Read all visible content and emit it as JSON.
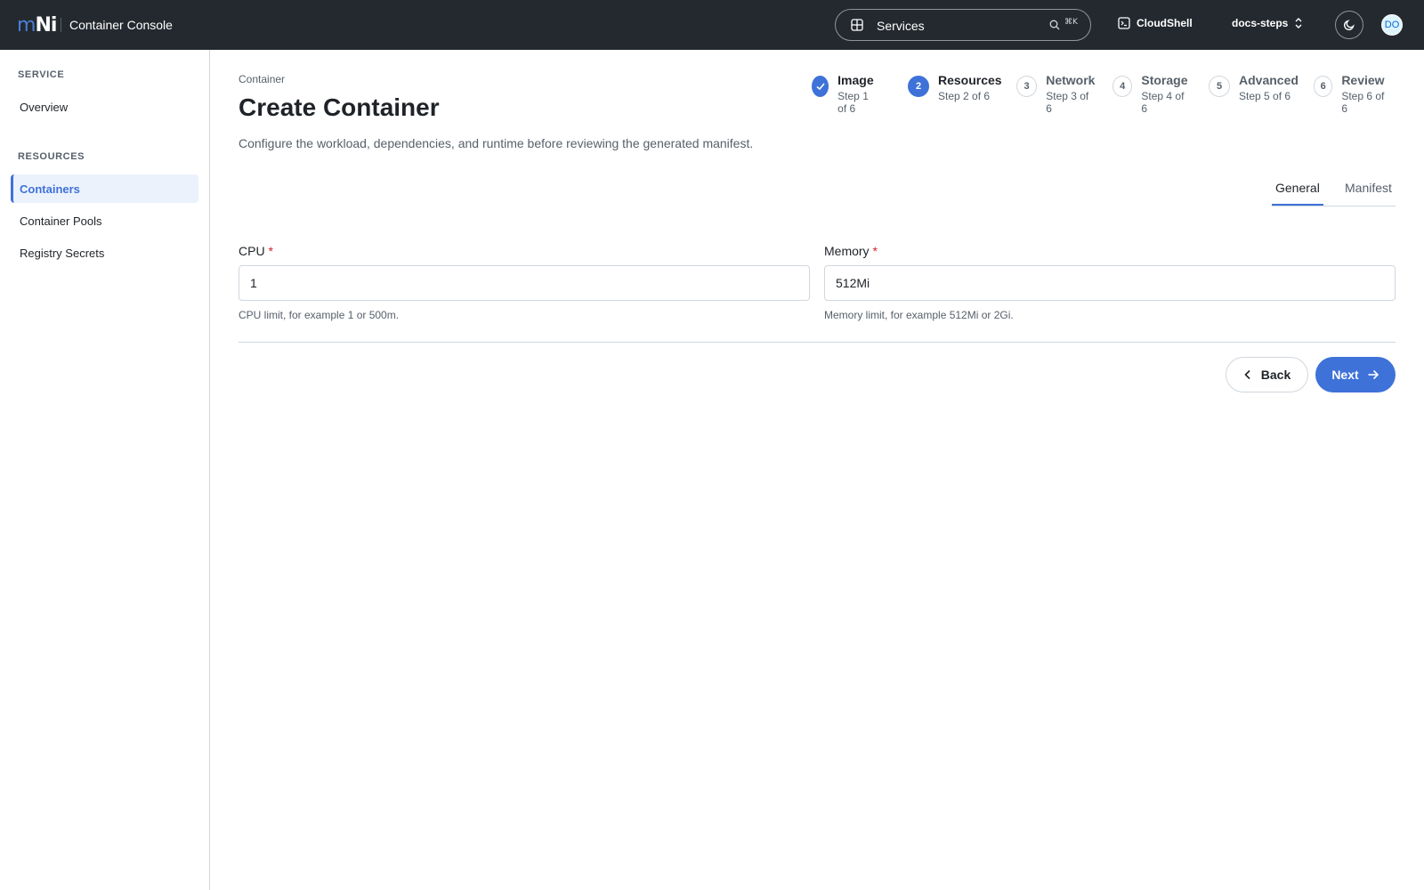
{
  "header": {
    "logo_m": "m",
    "logo_n": "Ni",
    "app_title": "Container Console",
    "search_label": "Services",
    "search_shortcut": "⌘K",
    "cloudshell_label": "CloudShell",
    "project_label": "docs-steps",
    "avatar_initials": "DO"
  },
  "sidebar": {
    "sections": [
      {
        "title": "SERVICE",
        "items": [
          {
            "label": "Overview",
            "active": false
          }
        ]
      },
      {
        "title": "RESOURCES",
        "items": [
          {
            "label": "Containers",
            "active": true
          },
          {
            "label": "Container Pools",
            "active": false
          },
          {
            "label": "Registry Secrets",
            "active": false
          }
        ]
      }
    ]
  },
  "main": {
    "breadcrumb": "Container",
    "title": "Create Container",
    "description": "Configure the workload, dependencies, and runtime before reviewing the generated manifest.",
    "steps": [
      {
        "number": "1",
        "name": "Image",
        "sub": "Step 1 of 6",
        "status": "done"
      },
      {
        "number": "2",
        "name": "Resources",
        "sub": "Step 2 of 6",
        "status": "current"
      },
      {
        "number": "3",
        "name": "Network",
        "sub": "Step 3 of 6",
        "status": "upcoming"
      },
      {
        "number": "4",
        "name": "Storage",
        "sub": "Step 4 of 6",
        "status": "upcoming"
      },
      {
        "number": "5",
        "name": "Advanced",
        "sub": "Step 5 of 6",
        "status": "upcoming"
      },
      {
        "number": "6",
        "name": "Review",
        "sub": "Step 6 of 6",
        "status": "upcoming"
      }
    ],
    "tabs": [
      {
        "label": "General",
        "active": true
      },
      {
        "label": "Manifest",
        "active": false
      }
    ],
    "fields": {
      "cpu": {
        "label": "CPU",
        "required_mark": "*",
        "value": "1",
        "help": "CPU limit, for example 1 or 500m."
      },
      "memory": {
        "label": "Memory",
        "required_mark": "*",
        "value": "512Mi",
        "help": "Memory limit, for example 512Mi or 2Gi."
      }
    },
    "buttons": {
      "back": "Back",
      "next": "Next"
    }
  },
  "colors": {
    "accent": "#3e72d8",
    "topbar": "#24292f",
    "required": "#cf222e"
  }
}
